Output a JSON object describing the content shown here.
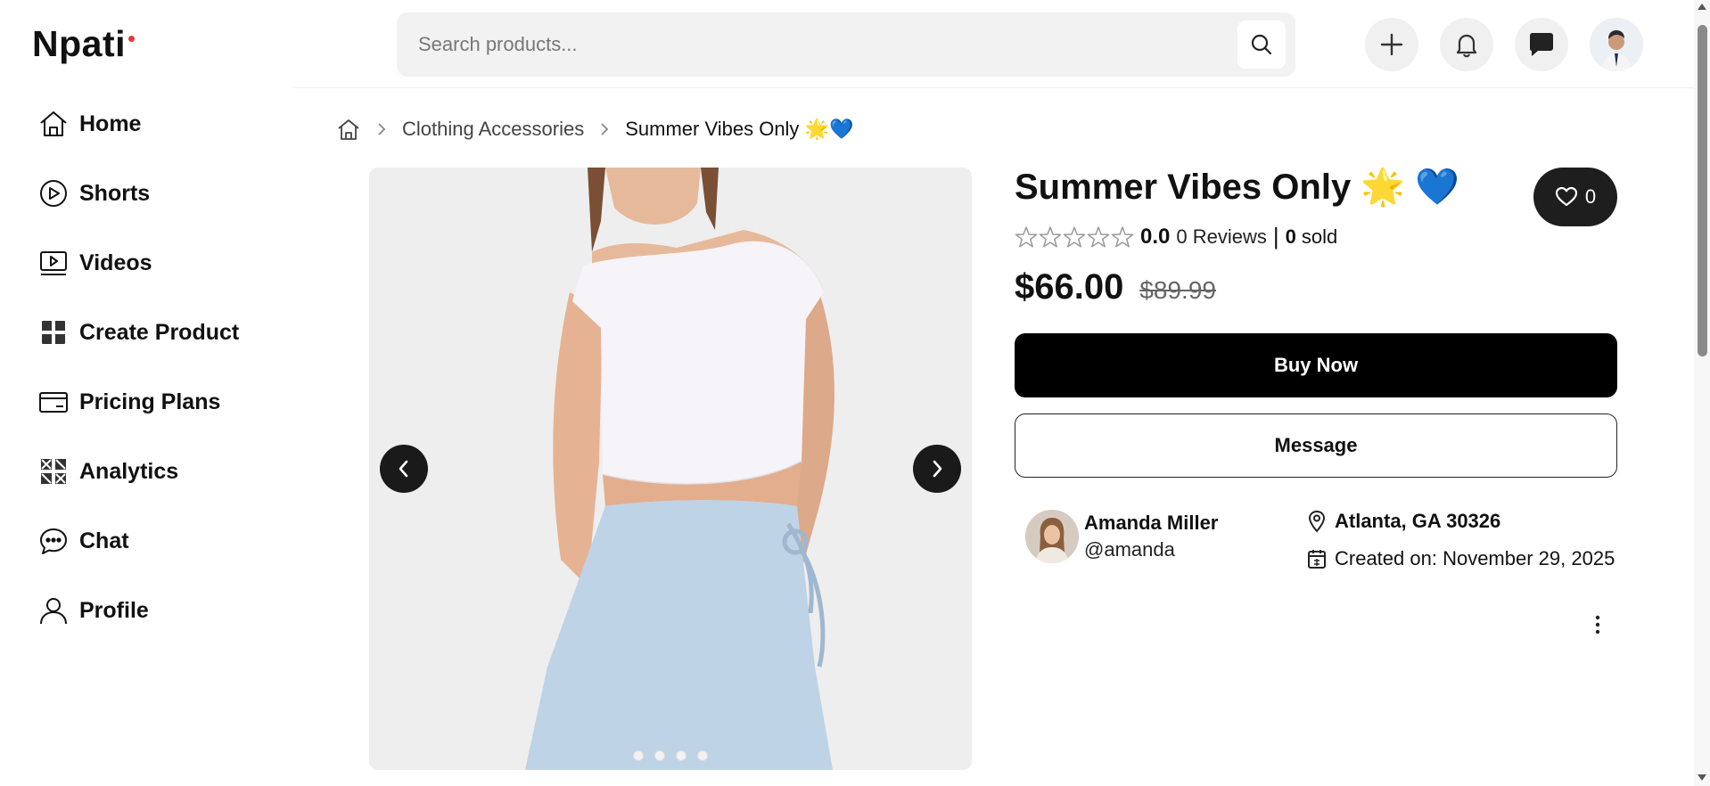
{
  "logo": {
    "text": "Npati",
    "dot_color": "#e53935"
  },
  "sidebar": {
    "items": [
      {
        "label": "Home",
        "icon": "home-icon"
      },
      {
        "label": "Shorts",
        "icon": "play-circle-icon"
      },
      {
        "label": "Videos",
        "icon": "video-icon"
      },
      {
        "label": "Create Product",
        "icon": "plus-icon"
      },
      {
        "label": "Pricing Plans",
        "icon": "card-icon"
      },
      {
        "label": "Analytics",
        "icon": "analytics-icon"
      },
      {
        "label": "Chat",
        "icon": "chat-bubble-icon"
      },
      {
        "label": "Profile",
        "icon": "user-icon"
      }
    ]
  },
  "header": {
    "search_placeholder": "Search products...",
    "search_value": "",
    "actions": [
      "plus-icon",
      "bell-icon",
      "message-icon",
      "avatar"
    ]
  },
  "breadcrumb": {
    "home_icon": "home-icon",
    "items": [
      "Clothing Accessories",
      "Summer Vibes Only 🌟💙"
    ]
  },
  "product": {
    "title": "Summer Vibes Only 🌟 💙",
    "favorites": "0",
    "rating": "0.0",
    "stars_filled": 0,
    "stars_total": 5,
    "reviews": "0 Reviews",
    "divider": "|",
    "sold_count": "0",
    "sold_label": "sold",
    "price": "$66.00",
    "old_price": "$89.99",
    "buy_label": "Buy Now",
    "message_label": "Message",
    "image_count": 4,
    "active_image": 1
  },
  "seller": {
    "name": "Amanda Miller",
    "handle": "@amanda",
    "location": "Atlanta, GA 30326",
    "created": "Created on: November 29, 2025"
  },
  "colors": {
    "primary": "#000000",
    "accent_red": "#e53935",
    "surface": "#f2f2f2"
  }
}
